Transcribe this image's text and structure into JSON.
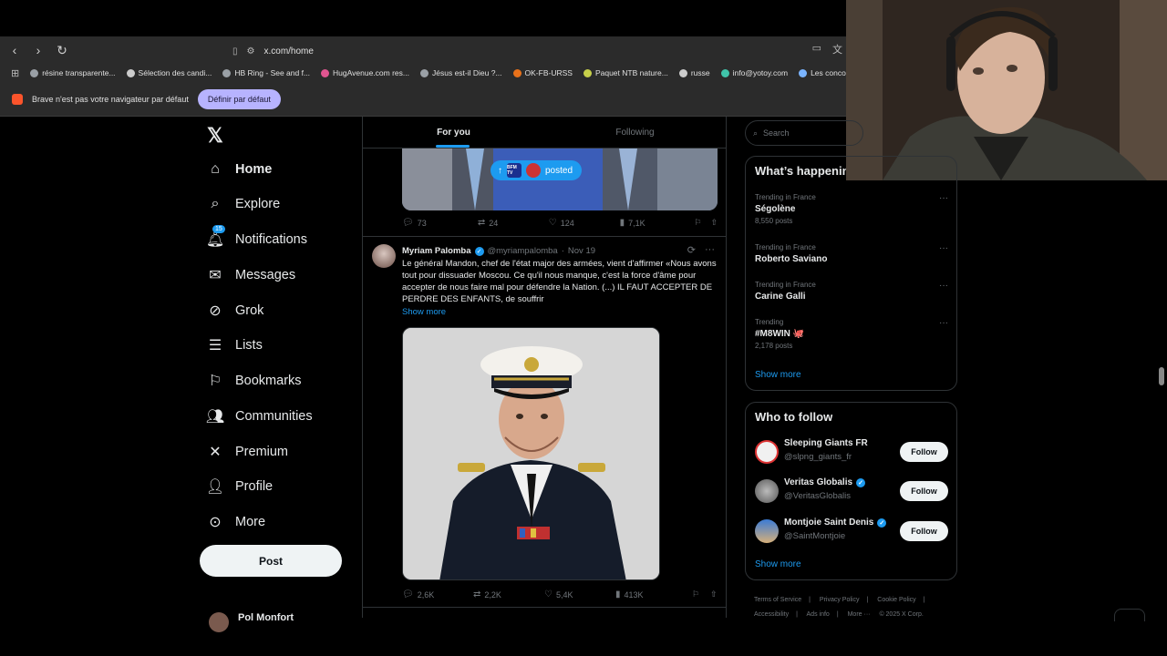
{
  "browser": {
    "url": "x.com/home",
    "bookmarks": [
      {
        "label": "résine transparente...",
        "color": "#9aa0a6"
      },
      {
        "label": "Sélection des candi...",
        "color": "#cccccc"
      },
      {
        "label": "HB Ring - See and f...",
        "color": "#9aa0a6"
      },
      {
        "label": "HugAvenue.com res...",
        "color": "#e05590"
      },
      {
        "label": "Jésus est-il Dieu ?...",
        "color": "#9aa0a6"
      },
      {
        "label": "OK-FB-URSS",
        "color": "#e8711a"
      },
      {
        "label": "Paquet NTB nature...",
        "color": "#c7d04a"
      },
      {
        "label": "russe",
        "color": "#cccccc"
      },
      {
        "label": "info@yotoy.com",
        "color": "#40c4aa"
      },
      {
        "label": "Les concours d'a",
        "color": "#7ab4ff"
      }
    ],
    "infobar_text": "Brave n'est pas votre navigateur par défaut",
    "infobar_button": "Définir par défaut"
  },
  "nav": {
    "items": [
      {
        "label": "Home",
        "icon": "home-icon",
        "bold": true
      },
      {
        "label": "Explore",
        "icon": "search-icon"
      },
      {
        "label": "Notifications",
        "icon": "bell-icon",
        "badge": "15"
      },
      {
        "label": "Messages",
        "icon": "envelope-icon"
      },
      {
        "label": "Grok",
        "icon": "grok-icon"
      },
      {
        "label": "Lists",
        "icon": "list-icon"
      },
      {
        "label": "Bookmarks",
        "icon": "bookmark-icon"
      },
      {
        "label": "Communities",
        "icon": "people-icon"
      },
      {
        "label": "Premium",
        "icon": "x-icon"
      },
      {
        "label": "Profile",
        "icon": "person-icon"
      },
      {
        "label": "More",
        "icon": "more-circle-icon"
      }
    ],
    "post_label": "Post",
    "account_name": "Pol Monfort"
  },
  "feed": {
    "tabs": [
      "For you",
      "Following"
    ],
    "prev_posted": "posted",
    "prev_pill_label": "BFM TV",
    "prev_stats": {
      "replies": "73",
      "reposts": "24",
      "likes": "124",
      "views": "7,1K"
    },
    "tweet": {
      "name": "Myriam Palomba",
      "handle": "@myriampalomba",
      "date": "Nov 19",
      "text": "Le général Mandon, chef de l'état major des armées,  vient d'affirmer «Nous avons tout pour dissuader Moscou. Ce qu'il nous manque, c'est la force d'âme pour accepter de nous faire mal pour défendre la Nation. (...) IL FAUT ACCEPTER DE PERDRE DES ENFANTS, de souffrir",
      "show_more": "Show more",
      "stats": {
        "replies": "2,6K",
        "reposts": "2,2K",
        "likes": "5,4K",
        "views": "413K"
      }
    }
  },
  "sidebar": {
    "search_placeholder": "Search",
    "trends_title": "What’s happening",
    "trends": [
      {
        "context": "Trending in France",
        "name": "Ségolène",
        "posts": "8,550 posts"
      },
      {
        "context": "Trending in France",
        "name": "Roberto Saviano",
        "posts": ""
      },
      {
        "context": "Trending in France",
        "name": "Carine Galli",
        "posts": ""
      },
      {
        "context": "Trending",
        "name": "#M8WIN 🐙",
        "posts": "2,178 posts"
      }
    ],
    "show_more": "Show more",
    "who_title": "Who to follow",
    "who": [
      {
        "name": "Sleeping Giants FR",
        "handle": "@slpng_giants_fr",
        "verified": false,
        "follow": "Follow"
      },
      {
        "name": "Veritas Globalis",
        "handle": "@VeritasGlobalis",
        "verified": true,
        "follow": "Follow"
      },
      {
        "name": "Montjoie Saint Denis",
        "handle": "@SaintMontjoie",
        "verified": true,
        "follow": "Follow"
      }
    ],
    "who_show_more": "Show more",
    "footer": [
      "Terms of Service",
      "|",
      "Privacy Policy",
      "|",
      "Cookie Policy",
      "|",
      "Accessibility",
      "|",
      "Ads info",
      "|",
      "More ···",
      "© 2025 X Corp."
    ]
  }
}
